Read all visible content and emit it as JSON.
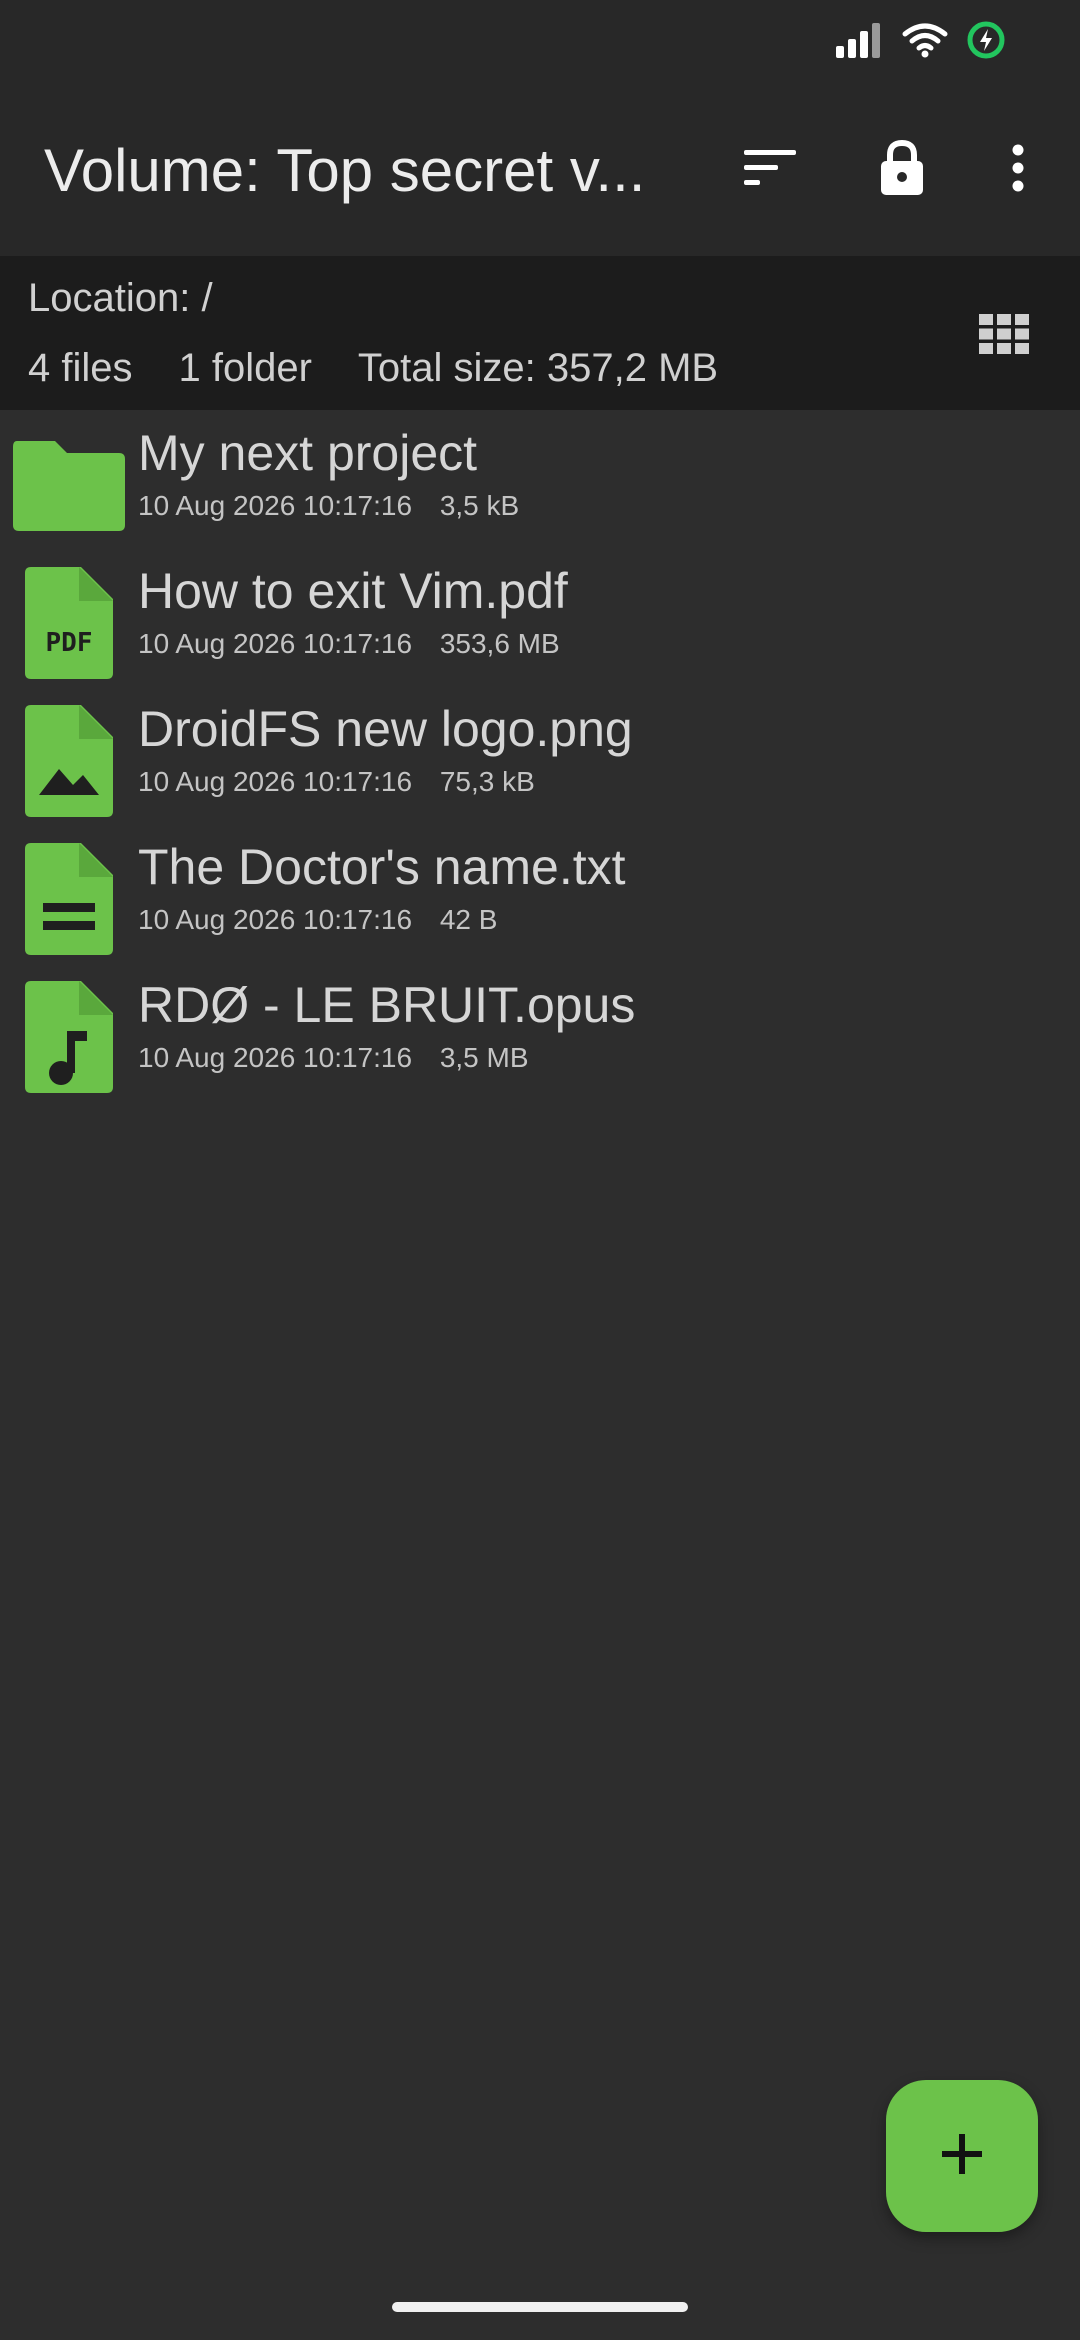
{
  "app": {
    "title": "Volume: Top secret v...",
    "accent_color": "#6cc24a"
  },
  "status_bar": {
    "icons": [
      "signal-icon",
      "wifi-icon",
      "battery-charging-icon"
    ]
  },
  "toolbar": {
    "actions": [
      "sort-icon",
      "lock-icon",
      "more-vert-icon"
    ]
  },
  "info": {
    "location": "Location: /",
    "files_count": "4 files",
    "folders_count": "1 folder",
    "total_size": "Total size: 357,2 MB",
    "view_toggle_icon": "grid-view-icon"
  },
  "files": [
    {
      "name": "My next project",
      "date": "10 Aug 2026 10:17:16",
      "size": "3,5 kB",
      "type": "folder"
    },
    {
      "name": "How to exit Vim.pdf",
      "date": "10 Aug 2026 10:17:16",
      "size": "353,6 MB",
      "type": "pdf",
      "icon_text": "PDF"
    },
    {
      "name": "DroidFS new logo.png",
      "date": "10 Aug 2026 10:17:16",
      "size": "75,3 kB",
      "type": "image"
    },
    {
      "name": "The Doctor's name.txt",
      "date": "10 Aug 2026 10:17:16",
      "size": "42 B",
      "type": "text"
    },
    {
      "name": "RDØ - LE BRUIT.opus",
      "date": "10 Aug 2026 10:17:16",
      "size": "3,5 MB",
      "type": "audio"
    }
  ],
  "fab": {
    "icon": "plus-icon"
  }
}
